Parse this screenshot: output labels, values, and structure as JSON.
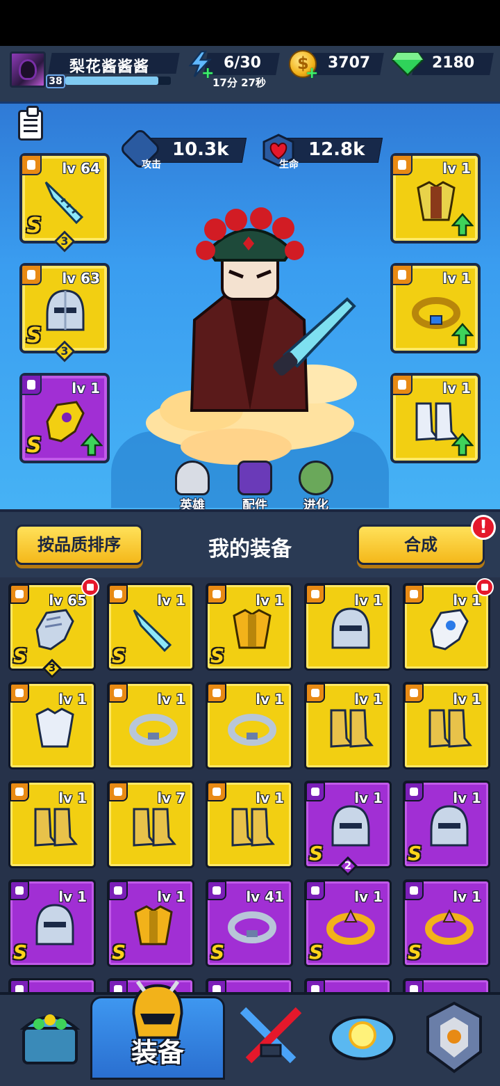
{
  "player": {
    "name": "梨花酱酱酱",
    "level": "38",
    "xp_fraction": 0.88
  },
  "resources": {
    "energy": "6/30",
    "energy_timer": "17分 27秒",
    "coins": "3707",
    "gems": "2180"
  },
  "stats": {
    "attack_value": "10.3k",
    "attack_label": "攻击",
    "health_value": "12.8k",
    "health_label": "生命"
  },
  "equipped": {
    "left": [
      {
        "lv": "lv 64",
        "rank": "S",
        "stars": "3",
        "color": "yellow",
        "icon": "knife-icon"
      },
      {
        "lv": "lv 63",
        "rank": "S",
        "stars": "3",
        "color": "yellow",
        "icon": "helmet-icon"
      },
      {
        "lv": "lv 1",
        "rank": "S",
        "stars": "",
        "color": "purple",
        "icon": "glove-icon",
        "upgrade": true
      }
    ],
    "right": [
      {
        "lv": "lv 1",
        "color": "yellow",
        "icon": "armor-icon",
        "upgrade": true
      },
      {
        "lv": "lv 1",
        "color": "yellow",
        "icon": "ring-icon",
        "upgrade": true
      },
      {
        "lv": "lv 1",
        "color": "yellow",
        "icon": "boots-icon",
        "upgrade": true
      }
    ]
  },
  "hero_tabs": {
    "hero": "英雄",
    "parts": "配件",
    "evolve": "进化"
  },
  "equipment_header": {
    "sort_button": "按品质排序",
    "title": "我的装备",
    "merge_button": "合成",
    "alert": "!"
  },
  "inventory": [
    {
      "lv": "lv 65",
      "rank": "S",
      "stars": "3",
      "color": "yellow",
      "icon": "gauntlet-icon",
      "tag": true
    },
    {
      "lv": "lv 1",
      "rank": "S",
      "stars": "",
      "color": "yellow",
      "icon": "knife-icon"
    },
    {
      "lv": "lv 1",
      "rank": "S",
      "stars": "",
      "color": "yellow",
      "icon": "gold-armor-icon"
    },
    {
      "lv": "lv 1",
      "rank": "",
      "stars": "",
      "color": "yellow",
      "icon": "helmet-icon"
    },
    {
      "lv": "lv 1",
      "rank": "",
      "stars": "",
      "color": "yellow",
      "icon": "glove-icon",
      "tag": true
    },
    {
      "lv": "lv 1",
      "rank": "",
      "stars": "",
      "color": "yellow",
      "icon": "armor-icon"
    },
    {
      "lv": "lv 1",
      "rank": "",
      "stars": "",
      "color": "yellow",
      "icon": "ring-icon"
    },
    {
      "lv": "lv 1",
      "rank": "",
      "stars": "",
      "color": "yellow",
      "icon": "ring-icon"
    },
    {
      "lv": "lv 1",
      "rank": "",
      "stars": "",
      "color": "yellow",
      "icon": "boots-icon"
    },
    {
      "lv": "lv 1",
      "rank": "",
      "stars": "",
      "color": "yellow",
      "icon": "boots-icon"
    },
    {
      "lv": "lv 1",
      "rank": "",
      "stars": "",
      "color": "yellow",
      "icon": "boots-icon"
    },
    {
      "lv": "lv 7",
      "rank": "",
      "stars": "",
      "color": "yellow",
      "icon": "boots-icon"
    },
    {
      "lv": "lv 1",
      "rank": "",
      "stars": "",
      "color": "yellow",
      "icon": "boots-icon"
    },
    {
      "lv": "lv 1",
      "rank": "S",
      "stars": "2",
      "color": "purple",
      "icon": "helmet-icon"
    },
    {
      "lv": "lv 1",
      "rank": "S",
      "stars": "",
      "color": "purple",
      "icon": "helmet-icon"
    },
    {
      "lv": "lv 1",
      "rank": "S",
      "stars": "",
      "color": "purple",
      "icon": "helmet-icon"
    },
    {
      "lv": "lv 1",
      "rank": "S",
      "stars": "",
      "color": "purple",
      "icon": "gold-armor-icon"
    },
    {
      "lv": "lv 41",
      "rank": "S",
      "stars": "",
      "color": "purple",
      "icon": "ring-icon"
    },
    {
      "lv": "lv 1",
      "rank": "S",
      "stars": "",
      "color": "purple",
      "icon": "crown-ring-icon"
    },
    {
      "lv": "lv 1",
      "rank": "S",
      "stars": "",
      "color": "purple",
      "icon": "crown-ring-icon"
    }
  ],
  "bottom_nav": {
    "active_label": "装备"
  },
  "colors": {
    "yellow_slot": "#f2cf12",
    "purple_slot": "#a12fd4",
    "panel_blue": "#3a9df0",
    "upgrade_green": "#3ed35a"
  }
}
